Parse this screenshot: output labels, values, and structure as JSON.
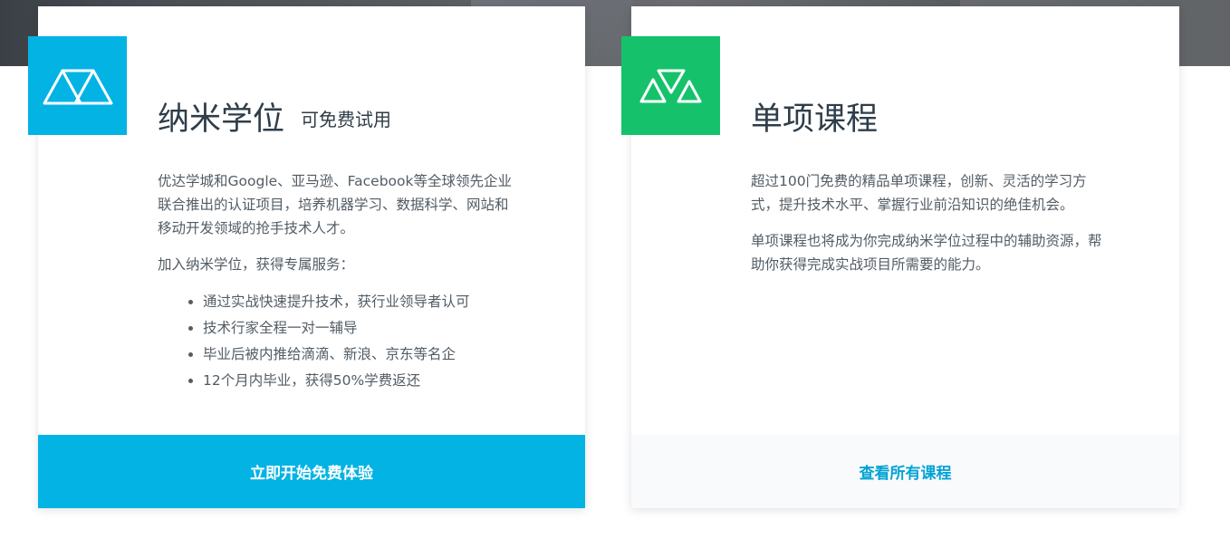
{
  "nanodegree": {
    "title": "纳米学位",
    "subtitle": "可免费试用",
    "description": "优达学城和Google、亚马逊、Facebook等全球领先企业联合推出的认证项目，培养机器学习、数据科学、网站和移动开发领域的抢手技术人才。",
    "benefits_intro": "加入纳米学位，获得专属服务：",
    "benefits": [
      "通过实战快速提升技术，获行业领导者认可",
      "技术行家全程一对一辅导",
      "毕业后被内推给滴滴、新浪、京东等名企",
      "12个月内毕业，获得50%学费返还"
    ],
    "cta": "立即开始免费体验",
    "logo_icon": "nanodegree-logo-icon",
    "accent_color": "#02b3e4"
  },
  "courses": {
    "title": "单项课程",
    "description": "超过100门免费的精品单项课程，创新、灵活的学习方式，提升技术水平、掌握行业前沿知识的绝佳机会。",
    "note": "单项课程也将成为你完成纳米学位过程中的辅助资源，帮助你获得完成实战项目所需要的能力。",
    "cta": "查看所有课程",
    "logo_icon": "courses-logo-icon",
    "accent_color": "#15c26b"
  }
}
